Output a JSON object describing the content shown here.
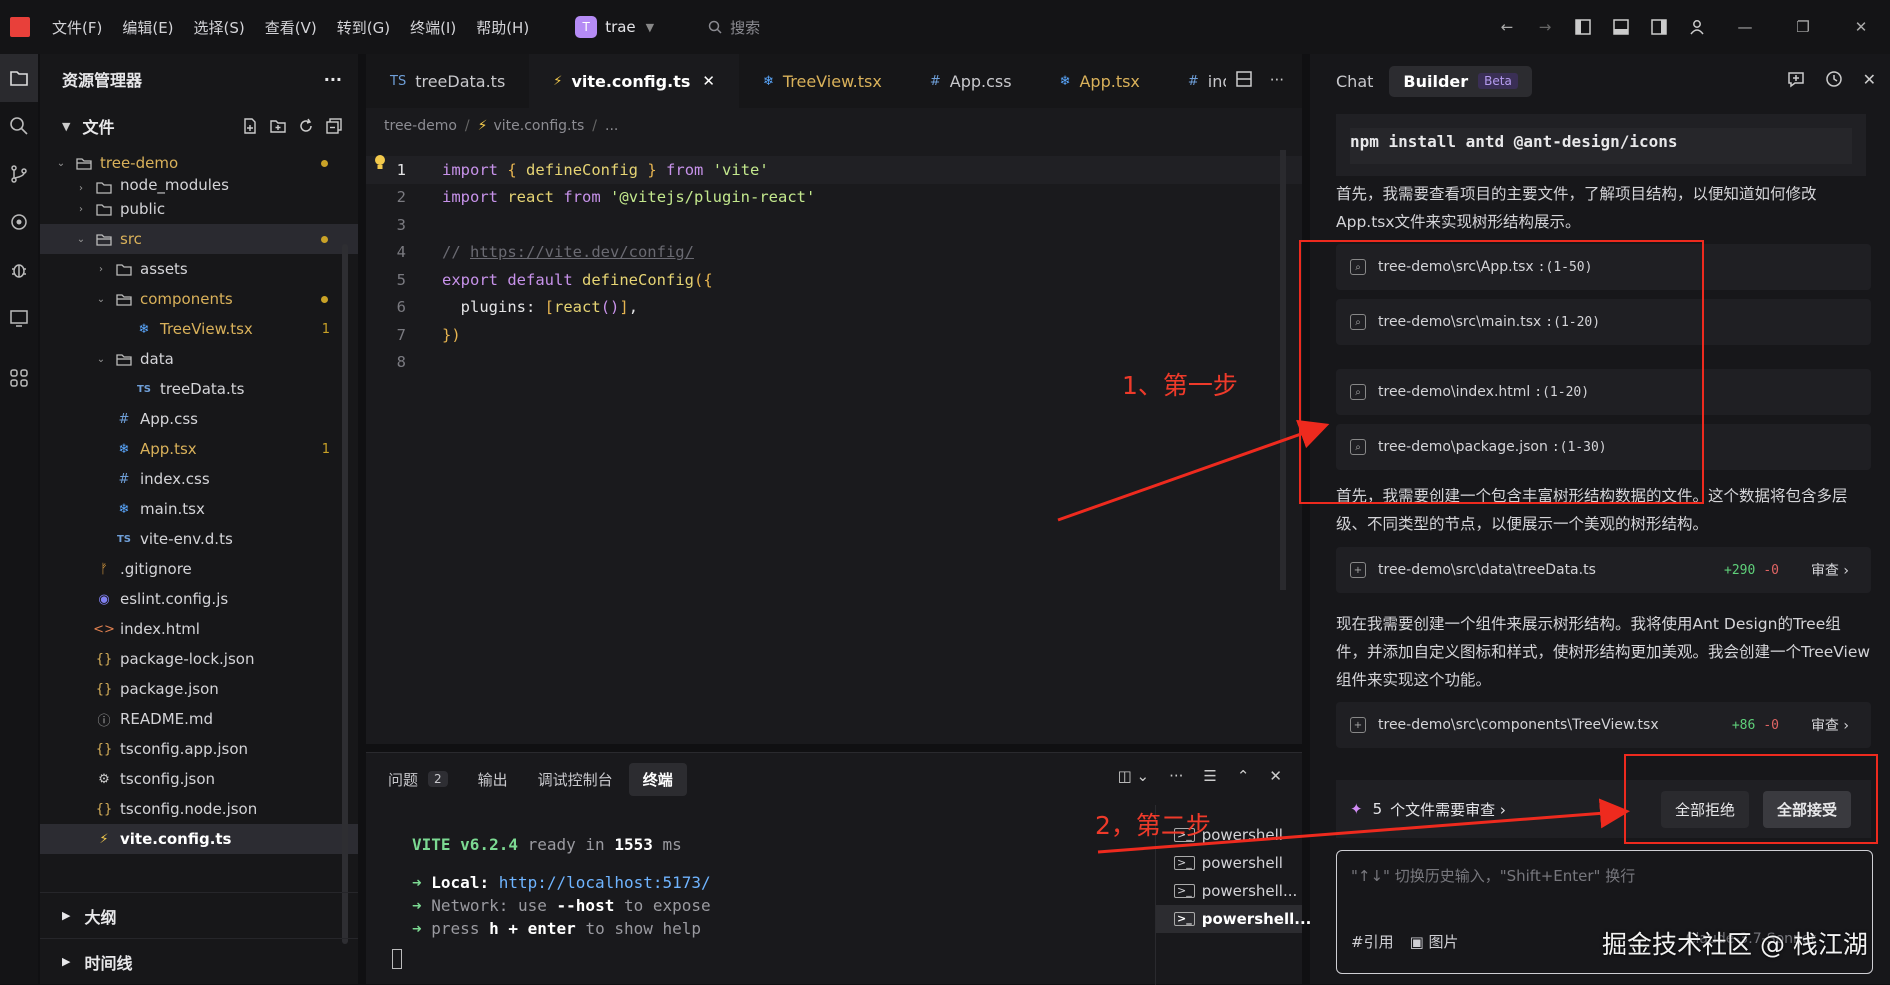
{
  "titlebar": {
    "menus": [
      "文件(F)",
      "编辑(E)",
      "选择(S)",
      "查看(V)",
      "转到(G)",
      "终端(I)",
      "帮助(H)"
    ],
    "project_badge": "T",
    "project_name": "trae",
    "search_label": "搜索"
  },
  "explorer": {
    "title": "资源管理器",
    "files_section": "文件",
    "outline_section": "大纲",
    "timeline_section": "时间线",
    "tree": [
      {
        "label": "tree-demo",
        "indent": 0,
        "type": "folder-open",
        "modified": true,
        "dot": true
      },
      {
        "label": "node_modules",
        "indent": 1,
        "type": "folder",
        "partial": true
      },
      {
        "label": "public",
        "indent": 1,
        "type": "folder"
      },
      {
        "label": "src",
        "indent": 1,
        "type": "folder-open",
        "modified": true,
        "dot": true,
        "selected": true
      },
      {
        "label": "assets",
        "indent": 2,
        "type": "folder"
      },
      {
        "label": "components",
        "indent": 2,
        "type": "folder-open",
        "modified": true,
        "dot": true
      },
      {
        "label": "TreeView.tsx",
        "indent": 3,
        "type": "react",
        "modified": true,
        "count": "1"
      },
      {
        "label": "data",
        "indent": 2,
        "type": "folder-open"
      },
      {
        "label": "treeData.ts",
        "indent": 3,
        "type": "ts"
      },
      {
        "label": "App.css",
        "indent": 2,
        "type": "css"
      },
      {
        "label": "App.tsx",
        "indent": 2,
        "type": "react",
        "modified": true,
        "count": "1"
      },
      {
        "label": "index.css",
        "indent": 2,
        "type": "css"
      },
      {
        "label": "main.tsx",
        "indent": 2,
        "type": "react"
      },
      {
        "label": "vite-env.d.ts",
        "indent": 2,
        "type": "ts"
      },
      {
        "label": ".gitignore",
        "indent": 1,
        "type": "git"
      },
      {
        "label": "eslint.config.js",
        "indent": 1,
        "type": "eslint"
      },
      {
        "label": "index.html",
        "indent": 1,
        "type": "html"
      },
      {
        "label": "package-lock.json",
        "indent": 1,
        "type": "json"
      },
      {
        "label": "package.json",
        "indent": 1,
        "type": "json"
      },
      {
        "label": "README.md",
        "indent": 1,
        "type": "info"
      },
      {
        "label": "tsconfig.app.json",
        "indent": 1,
        "type": "json"
      },
      {
        "label": "tsconfig.json",
        "indent": 1,
        "type": "gear"
      },
      {
        "label": "tsconfig.node.json",
        "indent": 1,
        "type": "json"
      },
      {
        "label": "vite.config.ts",
        "indent": 1,
        "type": "vite",
        "active": true
      }
    ]
  },
  "editor": {
    "tabs": [
      {
        "label": "treeData.ts",
        "icon": "TS",
        "color": "#6f9fd8"
      },
      {
        "label": "vite.config.ts",
        "icon": "⚡",
        "color": "#f2c94c",
        "active": true
      },
      {
        "label": "TreeView.tsx",
        "icon": "❄",
        "color": "#5aa8ff",
        "modified": true
      },
      {
        "label": "App.css",
        "icon": "#",
        "color": "#6f9fd8"
      },
      {
        "label": "App.tsx",
        "icon": "❄",
        "color": "#5aa8ff",
        "modified": true
      },
      {
        "label": "inde",
        "icon": "#",
        "color": "#6f9fd8"
      }
    ],
    "close_glyph": "✕",
    "breadcrumb": [
      "tree-demo",
      "vite.config.ts",
      "..."
    ],
    "line_numbers": [
      "1",
      "2",
      "3",
      "4",
      "5",
      "6",
      "7",
      "8"
    ]
  },
  "terminal": {
    "tabs": [
      {
        "label": "问题",
        "count": "2"
      },
      {
        "label": "输出"
      },
      {
        "label": "调试控制台"
      },
      {
        "label": "终端",
        "active": true
      }
    ],
    "lines": {
      "vite_name": "VITE v6.2.4",
      "ready": "ready in",
      "ready_ms": "1553",
      "ms": "ms",
      "local_label": "Local:",
      "local_url": "http://localhost:5173/",
      "network_label": "Network:",
      "network_text_a": "use",
      "network_flag": "--host",
      "network_text_b": "to expose",
      "help_a": "press",
      "help_key": "h + enter",
      "help_b": "to show help",
      "arrow": "➜"
    },
    "sessions": [
      "powershell",
      "powershell",
      "powershell...",
      "powershell..."
    ]
  },
  "chat": {
    "tab_chat": "Chat",
    "tab_builder": "Builder",
    "beta": "Beta",
    "command": "npm install antd @ant-design/icons",
    "para1": "首先，我需要查看项目的主要文件，了解项目结构，以便知道如何修改App.tsx文件来实现树形结构展示。",
    "refs": [
      {
        "path": "tree-demo\\src\\App.tsx",
        "range": ":(1-50)"
      },
      {
        "path": "tree-demo\\src\\main.tsx",
        "range": ":(1-20)"
      },
      {
        "path": "tree-demo\\index.html",
        "range": ":(1-20)"
      },
      {
        "path": "tree-demo\\package.json",
        "range": ":(1-30)"
      }
    ],
    "para2": "首先，我需要创建一个包含丰富树形结构数据的文件。这个数据将包含多层级、不同类型的节点，以便展示一个美观的树形结构。",
    "change1": {
      "path": "tree-demo\\src\\data\\treeData.ts",
      "add": "+290",
      "del": "-0",
      "review": "审查 ›"
    },
    "para3": "现在我需要创建一个组件来展示树形结构。我将使用Ant Design的Tree组件，并添加自定义图标和样式，使树形结构更加美观。我会创建一个TreeView组件来实现这个功能。",
    "change2": {
      "path": "tree-demo\\src\\components\\TreeView.tsx",
      "add": "+86",
      "del": "-0",
      "review": "审查 ›"
    },
    "review_count": "5",
    "review_label": "个文件需要审查 ›",
    "reject_all": "全部拒绝",
    "accept_all": "全部接受",
    "input_placeholder": "\"↑↓\" 切换历史输入，\"Shift+Enter\" 换行",
    "tool_ref": "#引用",
    "tool_image": "图片",
    "model_name": "Claude-3.7-Sonnet"
  },
  "annotations": {
    "step1": "1、第一步",
    "step2": "2，第二步",
    "color": "#ee2a1e"
  },
  "watermark": "掘金技术社区 @ 栈江湖"
}
